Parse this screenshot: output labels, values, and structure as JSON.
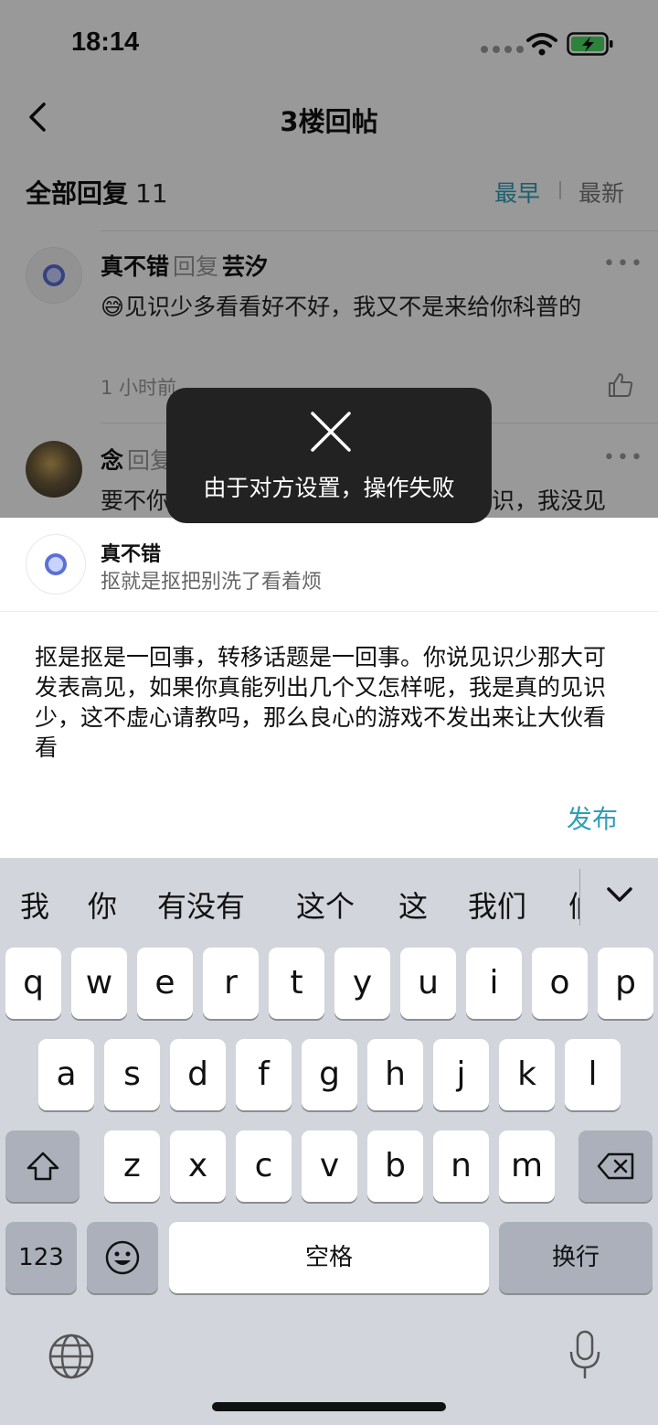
{
  "status_bar": {
    "time": "18:14"
  },
  "nav": {
    "title": "3楼回帖"
  },
  "reply_header": {
    "label": "全部回复",
    "count": "11",
    "sort_earliest": "最早",
    "sort_latest": "最新"
  },
  "comments": [
    {
      "user": "真不错",
      "reply_word": "回复",
      "target": "芸汐",
      "emoji": "😅",
      "text": "见识少多看看好不好，我又不是来给你科普的",
      "time": "1 小时前",
      "more": "•••"
    },
    {
      "user": "念",
      "reply_word": "回复",
      "target": "",
      "text_left": "要不你",
      "text_right": "识，我没见",
      "more": "•••"
    }
  ],
  "toast": {
    "message": "由于对方设置，操作失败",
    "icon": "close-x-icon"
  },
  "quote": {
    "user": "真不错",
    "text": "抠就是抠把别洗了看着烦"
  },
  "draft": {
    "text": "抠是抠是一回事，转移话题是一回事。你说见识少那大可发表高见，如果你真能列出几个又怎样呢，我是真的见识少，这不虚心请教吗，那么良心的游戏不发出来让大伙看看"
  },
  "publish": {
    "label": "发布"
  },
  "keyboard": {
    "candidates": [
      "我",
      "你",
      "有没有",
      "这个",
      "这",
      "我们",
      "们"
    ],
    "row1": [
      "q",
      "w",
      "e",
      "r",
      "t",
      "y",
      "u",
      "i",
      "o",
      "p"
    ],
    "row2": [
      "a",
      "s",
      "d",
      "f",
      "g",
      "h",
      "j",
      "k",
      "l"
    ],
    "row3": [
      "z",
      "x",
      "c",
      "v",
      "b",
      "n",
      "m"
    ],
    "numbers_label": "123",
    "space_label": "空格",
    "return_label": "换行"
  },
  "colors": {
    "accent": "#2f9fb6",
    "dim": "rgba(0,0,0,0.40)",
    "toast_bg": "#222222",
    "keyboard_bg": "#d2d5db"
  }
}
